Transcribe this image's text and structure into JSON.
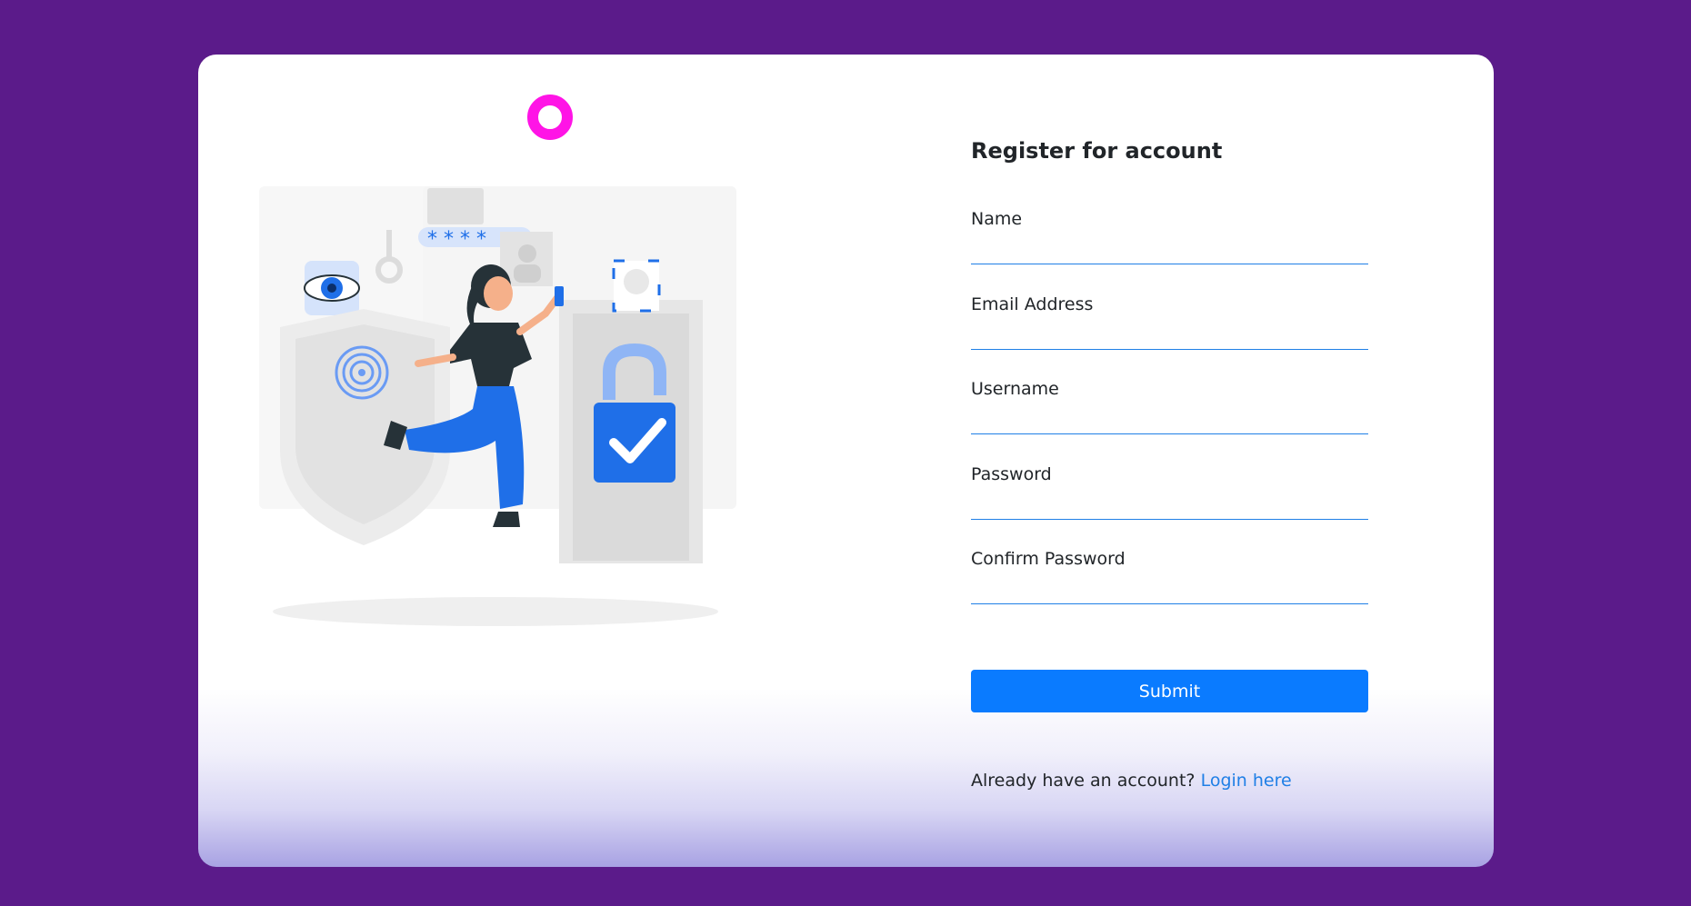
{
  "register_form": {
    "title": "Register for account",
    "fields": [
      {
        "label": "Name",
        "value": ""
      },
      {
        "label": "Email Address",
        "value": ""
      },
      {
        "label": "Username",
        "value": ""
      },
      {
        "label": "Password",
        "value": ""
      },
      {
        "label": "Confirm Password",
        "value": ""
      }
    ],
    "submit_label": "Submit",
    "login_prompt": "Already have an account?",
    "login_link": "Login here"
  },
  "colors": {
    "background": "#5b1b8a",
    "accent": "#0a7bff",
    "logo_ring": "#ff14e6",
    "link": "#1f7fe6"
  },
  "icons": [
    "logo-ring-icon",
    "security-illustration"
  ]
}
